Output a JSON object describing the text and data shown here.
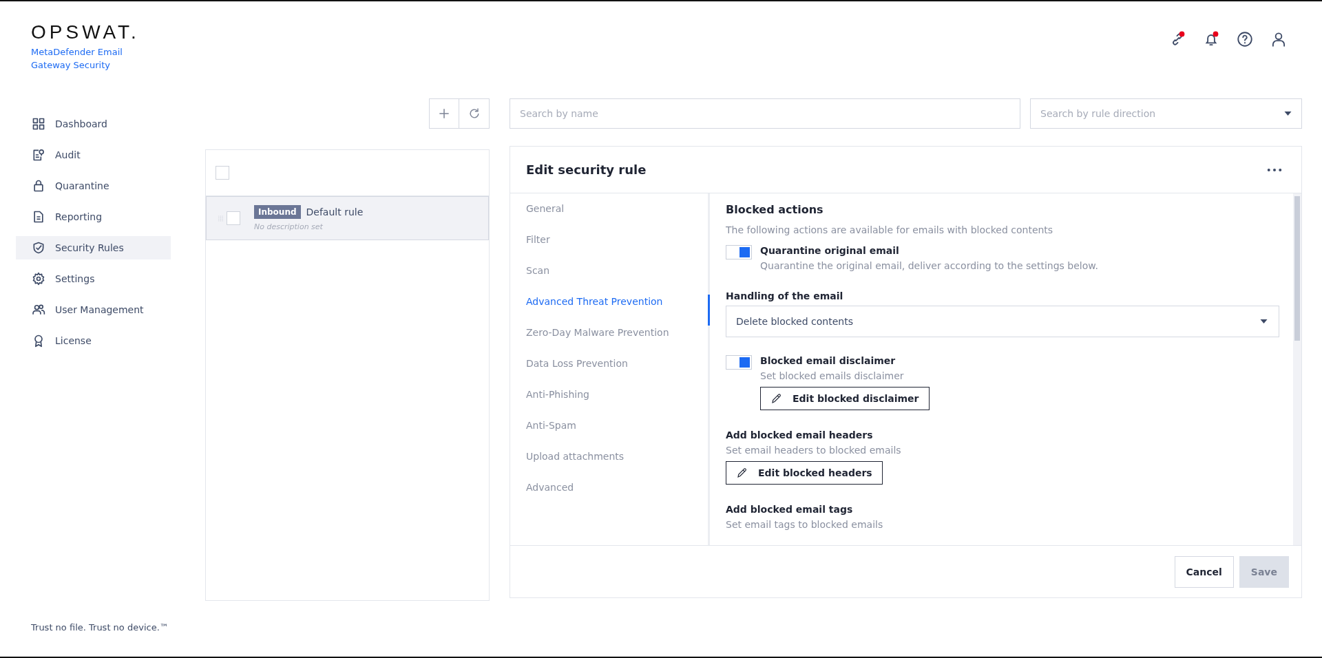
{
  "brand": {
    "logo": "OPSWAT.",
    "product": "MetaDefender Email Gateway Security"
  },
  "header_icons": [
    {
      "kind": "link",
      "badge": true
    },
    {
      "kind": "bell",
      "badge": true
    },
    {
      "kind": "help",
      "badge": false
    },
    {
      "kind": "user",
      "badge": false
    }
  ],
  "sidebar": {
    "items": [
      {
        "label": "Dashboard",
        "kind": "dashboard",
        "selected": false
      },
      {
        "label": "Audit",
        "kind": "audit",
        "selected": false
      },
      {
        "label": "Quarantine",
        "kind": "lock",
        "selected": false
      },
      {
        "label": "Reporting",
        "kind": "document",
        "selected": false
      },
      {
        "label": "Security Rules",
        "kind": "shield",
        "selected": true
      },
      {
        "label": "Settings",
        "kind": "gear",
        "selected": false
      },
      {
        "label": "User Management",
        "kind": "users",
        "selected": false
      },
      {
        "label": "License",
        "kind": "award",
        "selected": false
      }
    ],
    "tagline": "Trust no file. Trust no device.™"
  },
  "search": {
    "placeholder": "Search by name"
  },
  "direction_filter": {
    "placeholder": "Search by rule direction"
  },
  "rule_list": {
    "select_all_checked": false,
    "rules": [
      {
        "direction": "Inbound",
        "name": "Default rule",
        "description": "No description set",
        "checked": false,
        "selected": true
      }
    ]
  },
  "editor": {
    "title": "Edit security rule",
    "nav": [
      {
        "label": "General",
        "selected": false
      },
      {
        "label": "Filter",
        "selected": false
      },
      {
        "label": "Scan",
        "selected": false
      },
      {
        "label": "Advanced Threat Prevention",
        "selected": true
      },
      {
        "label": "Zero-Day Malware Prevention",
        "selected": false
      },
      {
        "label": "Data Loss Prevention",
        "selected": false
      },
      {
        "label": "Anti-Phishing",
        "selected": false
      },
      {
        "label": "Anti-Spam",
        "selected": false
      },
      {
        "label": "Upload attachments",
        "selected": false
      },
      {
        "label": "Advanced",
        "selected": false
      }
    ],
    "section_title": "Blocked actions",
    "section_description": "The following actions are available for emails with blocked contents",
    "blocks": [
      {
        "kind": "toggle",
        "label": "Quarantine original email",
        "description": "Quarantine the original email, deliver according to the settings below.",
        "on": true
      },
      {
        "kind": "select",
        "label": "Handling of the email",
        "value": "Delete blocked contents"
      },
      {
        "kind": "toggle",
        "label": "Blocked email disclaimer",
        "description": "Set blocked emails disclaimer",
        "on": true,
        "button": "Edit blocked disclaimer"
      },
      {
        "kind": "action",
        "label": "Add blocked email headers",
        "description": "Set email headers to blocked emails",
        "button": "Edit blocked headers"
      },
      {
        "kind": "action",
        "label": "Add blocked email tags",
        "description": "Set email tags to blocked emails"
      }
    ],
    "buttons": [
      {
        "label": "Cancel",
        "disabled": false
      },
      {
        "label": "Save",
        "disabled": true
      }
    ]
  }
}
